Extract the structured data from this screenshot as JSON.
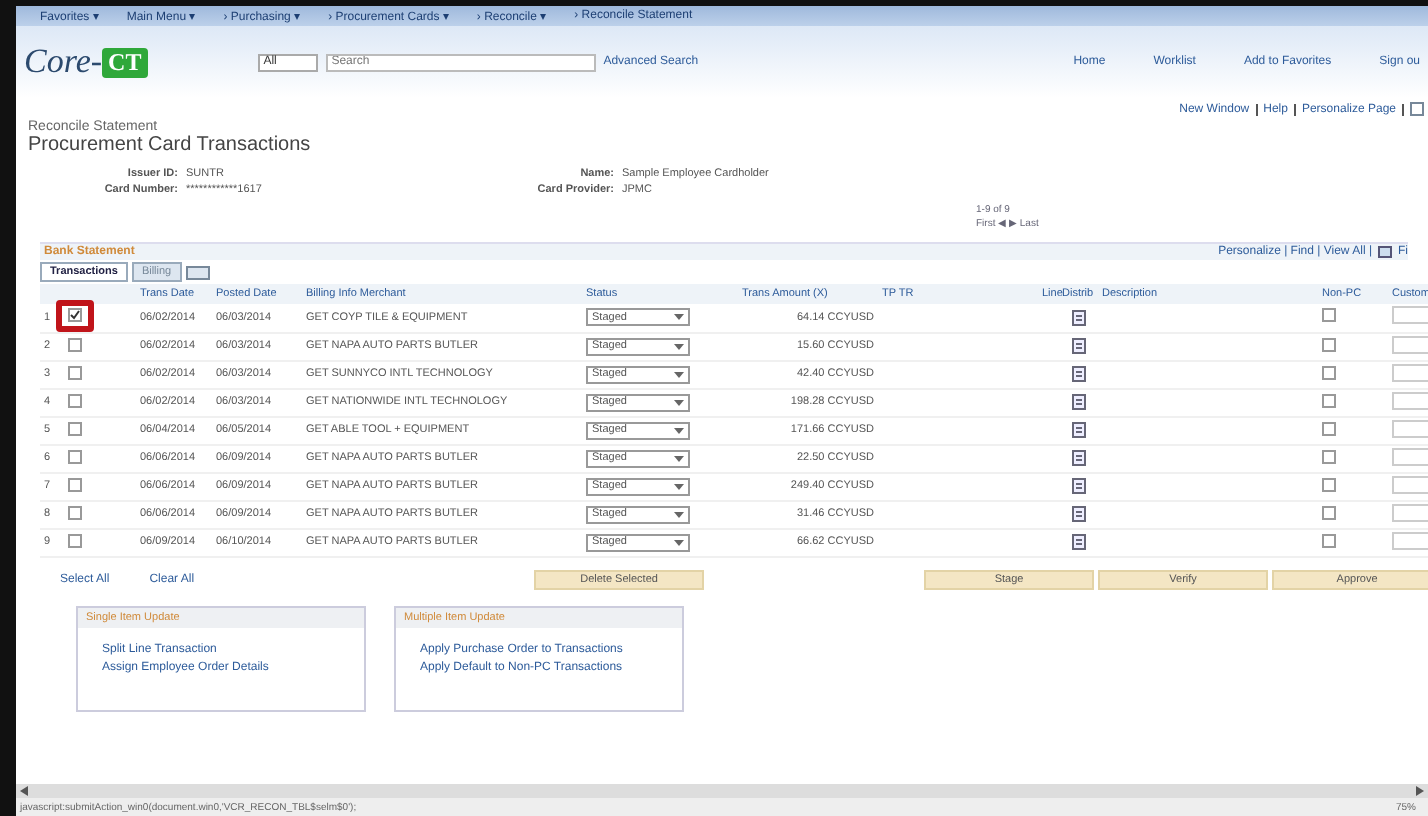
{
  "nav_menu": [
    "Favorites ▾",
    "Main Menu ▾",
    "› Purchasing ▾",
    "› Procurement Cards ▾",
    "› Reconcile ▾",
    "› Reconcile Statement"
  ],
  "logo": {
    "text": "Core-",
    "badge": "CT"
  },
  "search": {
    "scope": "All",
    "placeholder": "Search",
    "advanced": "Advanced Search"
  },
  "header_links": [
    "Home",
    "Worklist",
    "Add to Favorites",
    "Sign ou"
  ],
  "page_links": [
    "New Window",
    "Help",
    "Personalize Page"
  ],
  "breadcrumb": "Reconcile Statement",
  "title": "Procurement Card Transactions",
  "fields": [
    {
      "label": "Issuer ID:",
      "value": "SUNTR"
    },
    {
      "label": "Name:",
      "value": "Sample Employee Cardholder"
    },
    {
      "label": "Card Number:",
      "value": "************1617"
    },
    {
      "label": "Card Provider:",
      "value": "JPMC"
    }
  ],
  "pager": [
    "1-9 of 9",
    "First ◀ ▶ Last"
  ],
  "grid": {
    "title": "Bank Statement",
    "tabs": [
      {
        "label": "Transactions",
        "selected": true
      },
      {
        "label": "Billing",
        "selected": false
      }
    ],
    "toolbar": "Personalize | Find | View All |",
    "toolbar_end": "Fi",
    "columns": [
      "Trans Date",
      "Posted Date",
      "Billing Info Merchant",
      "Status",
      "Trans Amount (X)",
      "TP TR",
      "Line",
      "Distrib",
      "Description",
      "Non-PC",
      "Custom"
    ],
    "rows": [
      {
        "num": "1",
        "checked": true,
        "trans": "06/02/2014",
        "posted": "06/03/2014",
        "merchant": "GET COYP TILE & EQUIPMENT",
        "status": "Staged",
        "amount": "64.14 CCYUSD",
        "non_pc": false
      },
      {
        "num": "2",
        "checked": false,
        "trans": "06/02/2014",
        "posted": "06/03/2014",
        "merchant": "GET NAPA AUTO PARTS BUTLER",
        "status": "Staged",
        "amount": "15.60 CCYUSD",
        "non_pc": false
      },
      {
        "num": "3",
        "checked": false,
        "trans": "06/02/2014",
        "posted": "06/03/2014",
        "merchant": "GET SUNNYCO INTL TECHNOLOGY",
        "status": "Staged",
        "amount": "42.40 CCYUSD",
        "non_pc": false
      },
      {
        "num": "4",
        "checked": false,
        "trans": "06/02/2014",
        "posted": "06/03/2014",
        "merchant": "GET NATIONWIDE INTL TECHNOLOGY",
        "status": "Staged",
        "amount": "198.28 CCYUSD",
        "non_pc": false
      },
      {
        "num": "5",
        "checked": false,
        "trans": "06/04/2014",
        "posted": "06/05/2014",
        "merchant": "GET ABLE TOOL + EQUIPMENT",
        "status": "Staged",
        "amount": "171.66 CCYUSD",
        "non_pc": false
      },
      {
        "num": "6",
        "checked": false,
        "trans": "06/06/2014",
        "posted": "06/09/2014",
        "merchant": "GET NAPA AUTO PARTS BUTLER",
        "status": "Staged",
        "amount": "22.50 CCYUSD",
        "non_pc": false
      },
      {
        "num": "7",
        "checked": false,
        "trans": "06/06/2014",
        "posted": "06/09/2014",
        "merchant": "GET NAPA AUTO PARTS BUTLER",
        "status": "Staged",
        "amount": "249.40 CCYUSD",
        "non_pc": false
      },
      {
        "num": "8",
        "checked": false,
        "trans": "06/06/2014",
        "posted": "06/09/2014",
        "merchant": "GET NAPA AUTO PARTS BUTLER",
        "status": "Staged",
        "amount": "31.46 CCYUSD",
        "non_pc": false
      },
      {
        "num": "9",
        "checked": false,
        "trans": "06/09/2014",
        "posted": "06/10/2014",
        "merchant": "GET NAPA AUTO PARTS BUTLER",
        "status": "Staged",
        "amount": "66.62 CCYUSD",
        "non_pc": false
      }
    ]
  },
  "select_links": [
    "Select All",
    "Clear All"
  ],
  "left_buttons": [
    "Delete Selected"
  ],
  "right_buttons": [
    "Stage",
    "Verify",
    "Approve"
  ],
  "panels": [
    {
      "title": "Single Item Update",
      "links": [
        "Split Line Transaction",
        "Assign Employee Order Details"
      ]
    },
    {
      "title": "Multiple Item Update",
      "links": [
        "Apply Purchase Order to Transactions",
        "Apply Default to Non-PC Transactions"
      ]
    }
  ],
  "status_bar": {
    "url": "javascript:submitAction_win0(document.win0,'VCR_RECON_TBL$selm$0');",
    "zoom": "75%"
  }
}
